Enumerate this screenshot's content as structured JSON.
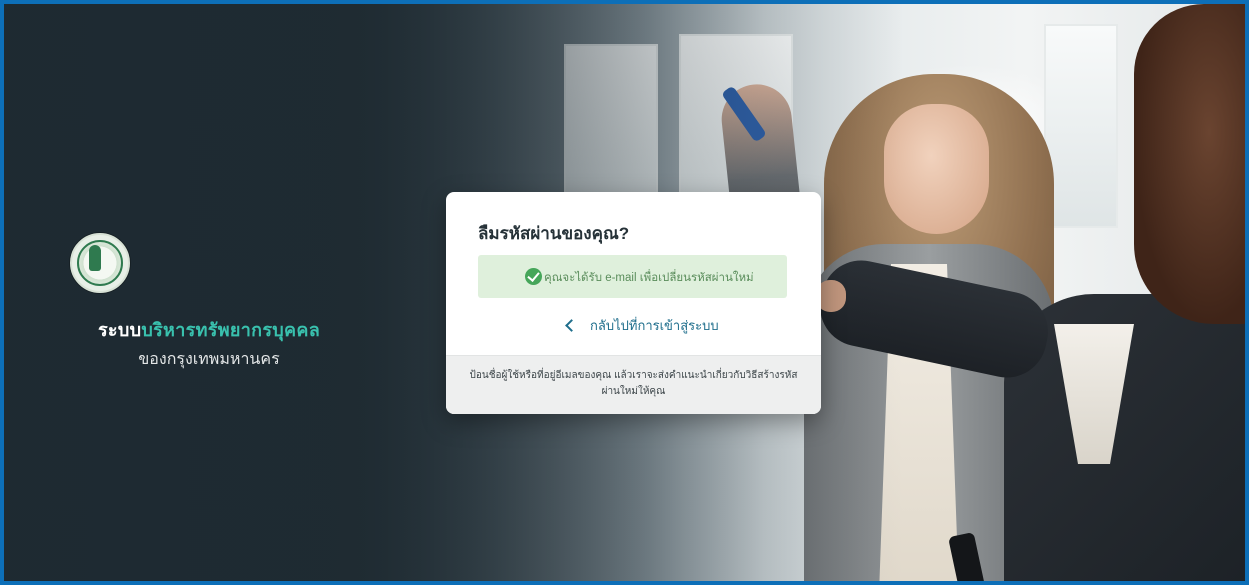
{
  "brand": {
    "title_part1": "ระบบ",
    "title_part2": "บริหารทรัพยากรบุคคล",
    "subtitle": "ของกรุงเทพมหานคร",
    "seal_icon": "bangkok-seal-icon",
    "accent_color": "#39c1ae"
  },
  "dialog": {
    "title": "ลืมรหัสผ่านของคุณ?",
    "success_message": "คุณจะได้รับ e-mail เพื่อเปลี่ยนรหัสผ่านใหม่",
    "success_icon": "check-circle-icon",
    "back_link": "กลับไปที่การเข้าสู่ระบบ",
    "back_icon": "chevron-left-icon",
    "footer_text": "ป้อนชื่อผู้ใช้หรือที่อยู่อีเมลของคุณ แล้วเราจะส่งคำแนะนำเกี่ยวกับวิธีสร้างรหัสผ่านใหม่ให้คุณ"
  },
  "colors": {
    "success_bg": "#dff0dc",
    "success_icon": "#46a65a",
    "link": "#1f6e8c",
    "frame_border": "#0d6fb8"
  }
}
